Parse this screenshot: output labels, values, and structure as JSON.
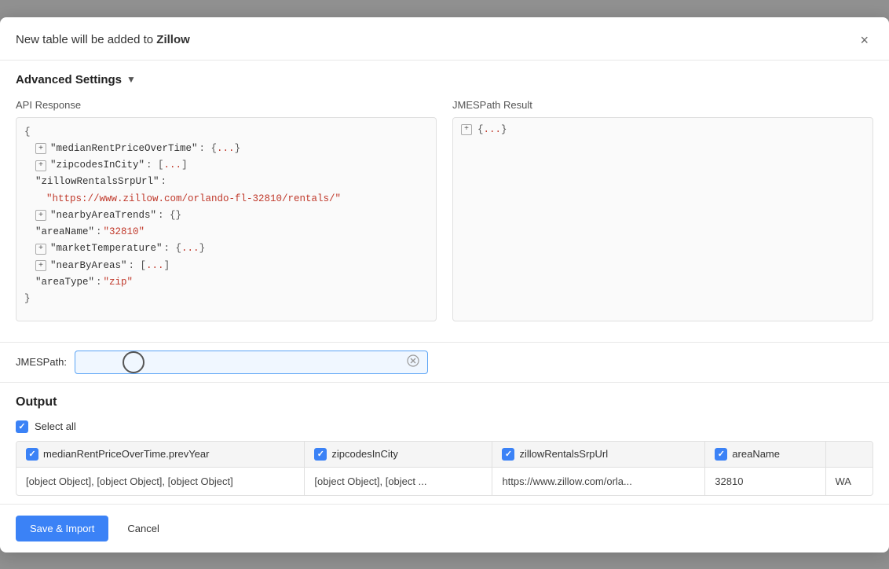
{
  "modal": {
    "title_prefix": "New table will be added to ",
    "title_app": "Zillow",
    "close_label": "×"
  },
  "advanced_settings": {
    "label": "Advanced Settings",
    "arrow": "▼",
    "api_response_label": "API Response",
    "jmes_result_label": "JMESPath Result",
    "json_tree": [
      {
        "indent": 0,
        "expandable": false,
        "text": "{"
      },
      {
        "indent": 1,
        "expandable": true,
        "key": "\"medianRentPriceOverTime\"",
        "value": " : {...}"
      },
      {
        "indent": 1,
        "expandable": true,
        "key": "\"zipcodesInCity\"",
        "value": " : [...]"
      },
      {
        "indent": 1,
        "expandable": false,
        "key": "\"zillowRentalsSrpUrl\"",
        "value": " :"
      },
      {
        "indent": 2,
        "expandable": false,
        "key": "",
        "value": "\"https://www.zillow.com/orlando-fl-32810/rentals/\"",
        "is_link": true
      },
      {
        "indent": 1,
        "expandable": true,
        "key": "\"nearbyAreaTrends\"",
        "value": " : {}"
      },
      {
        "indent": 1,
        "expandable": false,
        "key": "\"areaName\"",
        "value": " : ",
        "string_val": "\"32810\""
      },
      {
        "indent": 1,
        "expandable": true,
        "key": "\"marketTemperature\"",
        "value": " : {...}"
      },
      {
        "indent": 1,
        "expandable": true,
        "key": "\"nearByAreas\"",
        "value": " : [...]"
      },
      {
        "indent": 1,
        "expandable": false,
        "key": "\"areaType\"",
        "value": " : ",
        "string_val": "\"zip\""
      },
      {
        "indent": 0,
        "expandable": false,
        "text": "}"
      }
    ],
    "jmes_result": "{...}",
    "jmespath_label": "JMESPath:",
    "jmespath_placeholder": "",
    "jmespath_clear": "⊗"
  },
  "output": {
    "title": "Output",
    "select_all_label": "Select all",
    "columns": [
      {
        "name": "medianRentPriceOverTime.prevYear",
        "checked": true
      },
      {
        "name": "zipcodesInCity",
        "checked": true
      },
      {
        "name": "zillowRentalsSrpUrl",
        "checked": true
      },
      {
        "name": "areaName",
        "checked": true
      },
      {
        "name": "...",
        "checked": false
      }
    ],
    "rows": [
      {
        "col1": "[object Object], [object Object], [object Object]",
        "col2": "[object Object], [object ...",
        "col3": "https://www.zillow.com/orla...",
        "col4": "32810",
        "col5": "WA"
      }
    ]
  },
  "footer": {
    "save_label": "Save & Import",
    "cancel_label": "Cancel"
  }
}
